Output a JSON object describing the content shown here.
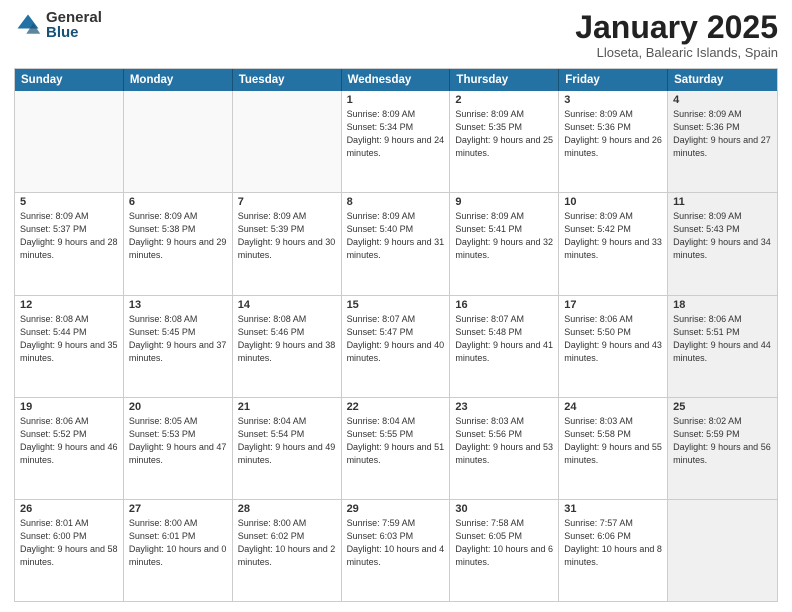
{
  "logo": {
    "general": "General",
    "blue": "Blue"
  },
  "title": "January 2025",
  "subtitle": "Lloseta, Balearic Islands, Spain",
  "days": [
    "Sunday",
    "Monday",
    "Tuesday",
    "Wednesday",
    "Thursday",
    "Friday",
    "Saturday"
  ],
  "weeks": [
    [
      {
        "num": "",
        "text": "",
        "empty": true
      },
      {
        "num": "",
        "text": "",
        "empty": true
      },
      {
        "num": "",
        "text": "",
        "empty": true
      },
      {
        "num": "1",
        "text": "Sunrise: 8:09 AM\nSunset: 5:34 PM\nDaylight: 9 hours and 24 minutes."
      },
      {
        "num": "2",
        "text": "Sunrise: 8:09 AM\nSunset: 5:35 PM\nDaylight: 9 hours and 25 minutes."
      },
      {
        "num": "3",
        "text": "Sunrise: 8:09 AM\nSunset: 5:36 PM\nDaylight: 9 hours and 26 minutes."
      },
      {
        "num": "4",
        "text": "Sunrise: 8:09 AM\nSunset: 5:36 PM\nDaylight: 9 hours and 27 minutes.",
        "shaded": true
      }
    ],
    [
      {
        "num": "5",
        "text": "Sunrise: 8:09 AM\nSunset: 5:37 PM\nDaylight: 9 hours and 28 minutes."
      },
      {
        "num": "6",
        "text": "Sunrise: 8:09 AM\nSunset: 5:38 PM\nDaylight: 9 hours and 29 minutes."
      },
      {
        "num": "7",
        "text": "Sunrise: 8:09 AM\nSunset: 5:39 PM\nDaylight: 9 hours and 30 minutes."
      },
      {
        "num": "8",
        "text": "Sunrise: 8:09 AM\nSunset: 5:40 PM\nDaylight: 9 hours and 31 minutes."
      },
      {
        "num": "9",
        "text": "Sunrise: 8:09 AM\nSunset: 5:41 PM\nDaylight: 9 hours and 32 minutes."
      },
      {
        "num": "10",
        "text": "Sunrise: 8:09 AM\nSunset: 5:42 PM\nDaylight: 9 hours and 33 minutes."
      },
      {
        "num": "11",
        "text": "Sunrise: 8:09 AM\nSunset: 5:43 PM\nDaylight: 9 hours and 34 minutes.",
        "shaded": true
      }
    ],
    [
      {
        "num": "12",
        "text": "Sunrise: 8:08 AM\nSunset: 5:44 PM\nDaylight: 9 hours and 35 minutes."
      },
      {
        "num": "13",
        "text": "Sunrise: 8:08 AM\nSunset: 5:45 PM\nDaylight: 9 hours and 37 minutes."
      },
      {
        "num": "14",
        "text": "Sunrise: 8:08 AM\nSunset: 5:46 PM\nDaylight: 9 hours and 38 minutes."
      },
      {
        "num": "15",
        "text": "Sunrise: 8:07 AM\nSunset: 5:47 PM\nDaylight: 9 hours and 40 minutes."
      },
      {
        "num": "16",
        "text": "Sunrise: 8:07 AM\nSunset: 5:48 PM\nDaylight: 9 hours and 41 minutes."
      },
      {
        "num": "17",
        "text": "Sunrise: 8:06 AM\nSunset: 5:50 PM\nDaylight: 9 hours and 43 minutes."
      },
      {
        "num": "18",
        "text": "Sunrise: 8:06 AM\nSunset: 5:51 PM\nDaylight: 9 hours and 44 minutes.",
        "shaded": true
      }
    ],
    [
      {
        "num": "19",
        "text": "Sunrise: 8:06 AM\nSunset: 5:52 PM\nDaylight: 9 hours and 46 minutes."
      },
      {
        "num": "20",
        "text": "Sunrise: 8:05 AM\nSunset: 5:53 PM\nDaylight: 9 hours and 47 minutes."
      },
      {
        "num": "21",
        "text": "Sunrise: 8:04 AM\nSunset: 5:54 PM\nDaylight: 9 hours and 49 minutes."
      },
      {
        "num": "22",
        "text": "Sunrise: 8:04 AM\nSunset: 5:55 PM\nDaylight: 9 hours and 51 minutes."
      },
      {
        "num": "23",
        "text": "Sunrise: 8:03 AM\nSunset: 5:56 PM\nDaylight: 9 hours and 53 minutes."
      },
      {
        "num": "24",
        "text": "Sunrise: 8:03 AM\nSunset: 5:58 PM\nDaylight: 9 hours and 55 minutes."
      },
      {
        "num": "25",
        "text": "Sunrise: 8:02 AM\nSunset: 5:59 PM\nDaylight: 9 hours and 56 minutes.",
        "shaded": true
      }
    ],
    [
      {
        "num": "26",
        "text": "Sunrise: 8:01 AM\nSunset: 6:00 PM\nDaylight: 9 hours and 58 minutes."
      },
      {
        "num": "27",
        "text": "Sunrise: 8:00 AM\nSunset: 6:01 PM\nDaylight: 10 hours and 0 minutes."
      },
      {
        "num": "28",
        "text": "Sunrise: 8:00 AM\nSunset: 6:02 PM\nDaylight: 10 hours and 2 minutes."
      },
      {
        "num": "29",
        "text": "Sunrise: 7:59 AM\nSunset: 6:03 PM\nDaylight: 10 hours and 4 minutes."
      },
      {
        "num": "30",
        "text": "Sunrise: 7:58 AM\nSunset: 6:05 PM\nDaylight: 10 hours and 6 minutes."
      },
      {
        "num": "31",
        "text": "Sunrise: 7:57 AM\nSunset: 6:06 PM\nDaylight: 10 hours and 8 minutes."
      },
      {
        "num": "",
        "text": "",
        "empty": true,
        "shaded": true
      }
    ]
  ]
}
